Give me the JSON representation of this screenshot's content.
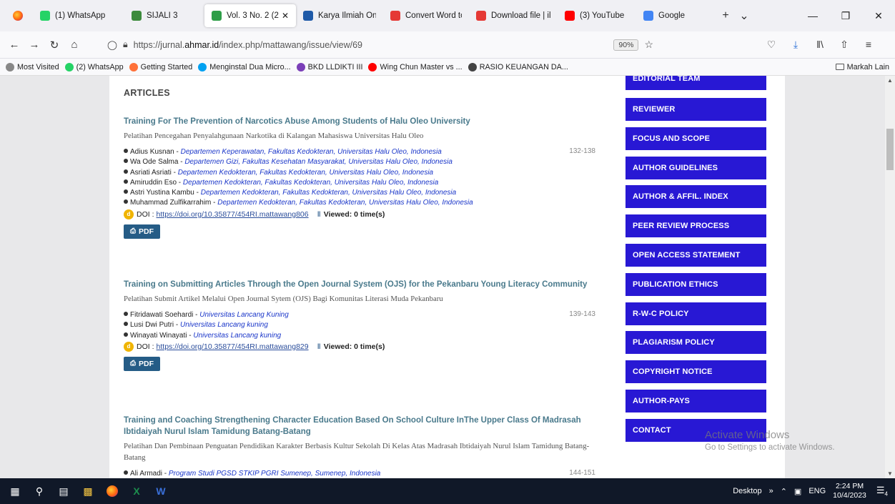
{
  "browser": {
    "tabs": [
      {
        "label": "(1) WhatsApp",
        "icon": "whatsapp-icon",
        "color": "#25d366",
        "active": false,
        "width": 128
      },
      {
        "label": "SIJALI 3",
        "icon": "sijali-icon",
        "color": "#3c8a3c",
        "active": false,
        "width": 112
      },
      {
        "label": "Vol. 3 No. 2 (2 ",
        "icon": "journal-icon",
        "color": "#2e9e48",
        "active": true,
        "width": 128
      },
      {
        "label": "Karya Ilmiah Onli",
        "icon": "karya-icon",
        "color": "#1f5aa8",
        "active": false,
        "width": 122
      },
      {
        "label": "Convert Word to",
        "icon": "heart-icon",
        "color": "#e53935",
        "active": false,
        "width": 120
      },
      {
        "label": "Download file | il",
        "icon": "heart-icon",
        "color": "#e53935",
        "active": false,
        "width": 124
      },
      {
        "label": "(3) YouTube",
        "icon": "youtube-icon",
        "color": "#ff0000",
        "active": false,
        "width": 110
      },
      {
        "label": "Google",
        "icon": "google-icon",
        "color": "#4285f4",
        "active": false,
        "width": 110
      }
    ],
    "url_prefix": "https://jurnal.",
    "url_domain": "ahmar.id",
    "url_path": "/index.php/mattawang/issue/view/69",
    "zoom": "90%",
    "bookmarks": [
      {
        "label": "Most Visited",
        "color": "#888888"
      },
      {
        "label": "(2) WhatsApp",
        "color": "#25d366"
      },
      {
        "label": "Getting Started",
        "color": "#ff7139"
      },
      {
        "label": "Menginstal Dua Micro...",
        "color": "#00a1f1"
      },
      {
        "label": "BKD LLDIKTI III",
        "color": "#7b3fb8"
      },
      {
        "label": "Wing Chun Master vs ...",
        "color": "#ff0000"
      },
      {
        "label": "RASIO KEUANGAN DA...",
        "color": "#444444"
      }
    ],
    "other_bookmarks": "Markah Lain"
  },
  "page": {
    "section_title": "ARTICLES",
    "articles": [
      {
        "title": "Training For The Prevention of Narcotics Abuse Among Students of Halu Oleo University",
        "subtitle": "Pelatihan Pencegahan Penyalahgunaan Narkotika di Kalangan Mahasiswa Universitas Halu Oleo",
        "pages": "132-138",
        "authors": [
          {
            "name": "Adius Kusnan",
            "aff": "Departemen Keperawatan, Fakultas Kedokteran, Universitas Halu Oleo, Indonesia"
          },
          {
            "name": "Wa Ode Salma",
            "aff": "Departemen Gizi, Fakultas Kesehatan Masyarakat, Universitas Halu Oleo, Indonesia"
          },
          {
            "name": "Asriati Asriati",
            "aff": "Departemen Kedokteran, Fakultas Kedokteran, Universitas Halu Oleo, Indonesia"
          },
          {
            "name": "Amiruddin Eso",
            "aff": "Departemen Kedokteran, Fakultas Kedokteran, Universitas Halu Oleo, Indonesia"
          },
          {
            "name": "Astri Yustina Kambu",
            "aff": "Departemen Kedokteran, Fakultas Kedokteran, Universitas Halu Oleo, Indonesia"
          },
          {
            "name": "Muhammad Zulfikarrahim",
            "aff": "Departemen Kedokteran, Fakultas Kedokteran, Universitas Halu Oleo, Indonesia"
          }
        ],
        "doi_label": "DOI :",
        "doi": "https://doi.org/10.35877/454RI.mattawang806",
        "viewed": "Viewed: 0 time(s)",
        "pdf_label": "PDF"
      },
      {
        "title": "Training on Submitting Articles Through the Open Journal System (OJS) for the Pekanbaru Young Literacy Community",
        "subtitle": "Pelatihan Submit Artikel Melalui Open Journal Sytem (OJS) Bagi Komunitas Literasi Muda Pekanbaru",
        "pages": "139-143",
        "authors": [
          {
            "name": "Fitridawati Soehardi",
            "aff": "Universitas Lancang Kuning"
          },
          {
            "name": "Lusi Dwi Putri",
            "aff": "Universitas Lancang kuning"
          },
          {
            "name": "Winayati Winayati",
            "aff": "Universitas Lancang kuning"
          }
        ],
        "doi_label": "DOI :",
        "doi": "https://doi.org/10.35877/454RI.mattawang829",
        "viewed": "Viewed: 0 time(s)",
        "pdf_label": "PDF"
      },
      {
        "title": "Training and Coaching Strengthening Character Education Based On School Culture InThe Upper Class Of Madrasah Ibtidaiyah Nurul Islam Tamidung Batang-Batang",
        "subtitle": "Pelatihan Dan Pembinaan Penguatan Pendidikan Karakter Berbasis Kultur Sekolah Di Kelas Atas Madrasah Ibtidaiyah Nurul Islam Tamidung Batang-Batang",
        "pages": "144-151",
        "authors": [
          {
            "name": "Ali Armadi",
            "aff": "Program Studi PGSD STKIP PGRI Sumenep, Sumenep, Indonesia"
          }
        ]
      }
    ],
    "sidebar": [
      "EDITORIAL TEAM",
      "REVIEWER",
      "FOCUS AND SCOPE",
      "AUTHOR GUIDELINES",
      "AUTHOR & AFFIL. INDEX",
      "PEER REVIEW PROCESS",
      "OPEN ACCESS STATEMENT",
      "PUBLICATION ETHICS",
      "R-W-C POLICY",
      "PLAGIARISM POLICY",
      "COPYRIGHT NOTICE",
      "AUTHOR-PAYS",
      "CONTACT"
    ],
    "accent_color": "#2818d4"
  },
  "watermark": {
    "line1": "Activate Windows",
    "line2": "Go to Settings to activate Windows."
  },
  "taskbar": {
    "desktop_label": "Desktop",
    "language": "ENG",
    "time": "2:24 PM",
    "date": "10/4/2023",
    "notification_count": "4"
  }
}
